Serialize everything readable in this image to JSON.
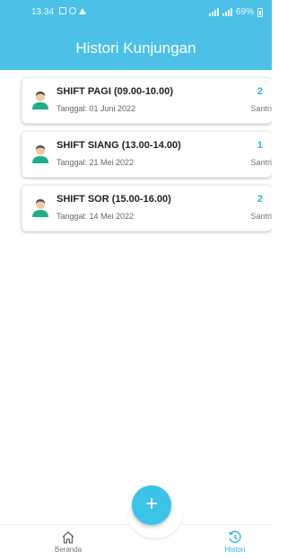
{
  "status_bar": {
    "time": "13.34",
    "battery": "69%"
  },
  "header": {
    "title": "Histori Kunjungan"
  },
  "visits": [
    {
      "shift": "SHIFT PAGI (09.00-10.00)",
      "date": "Tanggal: 01 Juni 2022",
      "count": "2",
      "unit": "Santri"
    },
    {
      "shift": "SHIFT SIANG (13.00-14.00)",
      "date": "Tanggal: 21 Mei 2022",
      "count": "1",
      "unit": "Santri"
    },
    {
      "shift": "SHIFT SOR (15.00-16.00)",
      "date": "Tanggal: 14 Mei 2022",
      "count": "2",
      "unit": "Santri"
    }
  ],
  "bottom_nav": {
    "home_label": "Beranda",
    "history_label": "Histori",
    "fab_label": "+"
  },
  "colors": {
    "header": "#4cc0e6",
    "accent": "#2bb6e0",
    "avatar_shirt": "#1fae8c"
  },
  "icons": {
    "avatar": "user-avatar-icon",
    "home": "home-icon",
    "history": "history-icon",
    "fab": "plus-icon"
  }
}
